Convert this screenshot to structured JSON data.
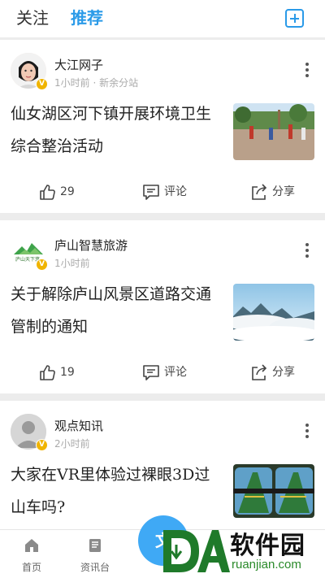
{
  "header": {
    "tab_follow": "关注",
    "tab_recommend": "推荐",
    "add_icon": "plus-square-icon",
    "accent": "#2a9ae8"
  },
  "feed": [
    {
      "author": "大江网子",
      "time": "1小时前 · 新余分站",
      "title": "仙女湖区河下镇开展环境卫生综合整治活动",
      "likes": "29",
      "comment_label": "评论",
      "share_label": "分享"
    },
    {
      "author": "庐山智慧旅游",
      "time": "1小时前",
      "title": "关于解除庐山风景区道路交通管制的通知",
      "likes": "19",
      "comment_label": "评论",
      "share_label": "分享"
    },
    {
      "author": "观点知讯",
      "time": "2小时前",
      "title": "大家在VR里体验过裸眼3D过山车吗?"
    }
  ],
  "bottom_nav": [
    {
      "label": "首页",
      "icon": "home-icon"
    },
    {
      "label": "资讯台",
      "icon": "news-desk-icon"
    }
  ],
  "fab": {
    "label": "文"
  },
  "watermark": {
    "text": "软件园",
    "url": "ruanjian.com",
    "mark": "DA"
  },
  "verified_badge": "V"
}
